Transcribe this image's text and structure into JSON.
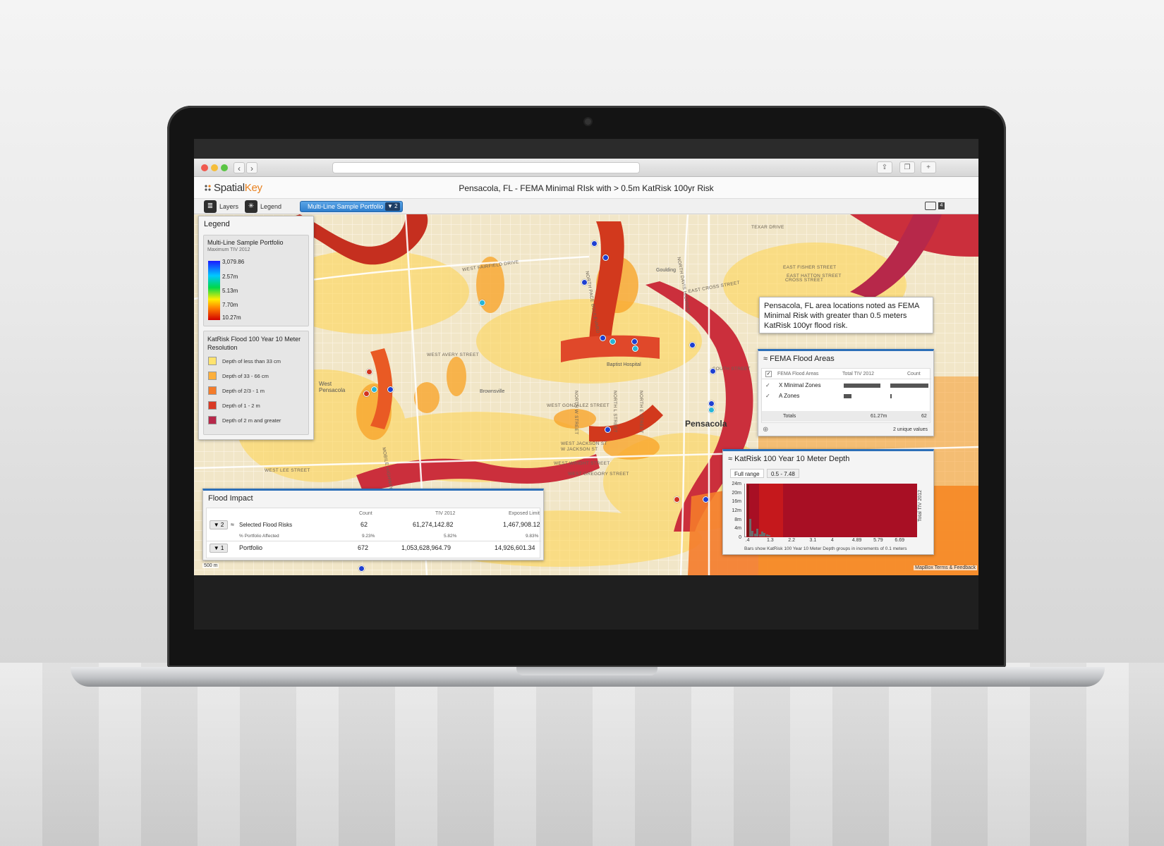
{
  "browser": {
    "traffic_lights": [
      "#f05a4f",
      "#f5bd3a",
      "#5ac544"
    ],
    "back": "‹",
    "forward": "›"
  },
  "app": {
    "logo_prefix": "Spatial",
    "logo_suffix": "Key",
    "page_title": "Pensacola, FL - FEMA Minimal RIsk with > 0.5m KatRisk 100yr Risk"
  },
  "toolbar": {
    "layers_label": "Layers",
    "legend_label": "Legend",
    "portfolio_pill": "Multi-Line Sample Portfolio",
    "portfolio_badge": "2",
    "screens_count": "4"
  },
  "legend": {
    "title": "Legend",
    "portfolio": {
      "title": "Multi-Line Sample Portfolio",
      "subtitle": "Maximum TIV 2012",
      "scale": [
        "3,079.86",
        "2.57m",
        "5.13m",
        "7.70m",
        "10.27m"
      ]
    },
    "flood": {
      "title": "KatRisk Flood 100 Year 10 Meter Resolution",
      "items": [
        {
          "label": "Depth of less than 33 cm",
          "color": "#ffe36e"
        },
        {
          "label": "Depth of 33 - 66 cm",
          "color": "#fcaf3b"
        },
        {
          "label": "Depth of 2/3 - 1 m",
          "color": "#f47b2a"
        },
        {
          "label": "Depth of 1 - 2 m",
          "color": "#d93a25"
        },
        {
          "label": "Depth of 2 m and greater",
          "color": "#b7284a"
        }
      ]
    }
  },
  "callout": {
    "text": "Pensacola, FL area locations noted as FEMA Minimal Risk with greater than 0.5 meters KatRisk 100yr flood risk."
  },
  "fema": {
    "title": "FEMA Flood Areas",
    "headers": [
      "FEMA Flood Areas",
      "Total TIV 2012",
      "Count"
    ],
    "rows": [
      {
        "name": "X Minimal Zones",
        "tiv_fraction": 0.96,
        "count_fraction": 0.97
      },
      {
        "name": "A Zones",
        "tiv_fraction": 0.2,
        "count_fraction": 0.04
      }
    ],
    "totals_label": "Totals",
    "totals_tiv": "61.27m",
    "totals_count": "62",
    "unique": "2 unique values"
  },
  "katrisk": {
    "title": "KatRisk 100 Year 10 Meter Depth",
    "chip_full": "Full range",
    "chip_range": "0.5 - 7.48",
    "y_axis_label": "Total TIV 2012",
    "footnote": "Bars show KatRisk 100 Year 10 Meter Depth groups in increments of 0.1 meters"
  },
  "chart_data": {
    "type": "bar",
    "title": "KatRisk 100 Year 10 Meter Depth",
    "ylabel": "Total TIV 2012",
    "xlabel": "",
    "y_ticks": [
      "24m",
      "20m",
      "16m",
      "12m",
      "8m",
      "4m",
      "0"
    ],
    "x_ticks": [
      ".4",
      "1.3",
      "2.2",
      "3.1",
      "4",
      "4.89",
      "5.79",
      "6.69"
    ],
    "ylim": [
      0,
      24
    ],
    "x": [
      0.4,
      0.5,
      0.6,
      0.7,
      0.8,
      0.9,
      1.0,
      1.1,
      1.2,
      1.3
    ],
    "values": [
      23,
      8,
      2.5,
      1.2,
      3.5,
      1.0,
      2.2,
      1.5,
      0.8,
      0.6
    ],
    "selected_range": [
      0.5,
      7.48
    ]
  },
  "flood_impact": {
    "title": "Flood Impact",
    "headers": [
      "Count",
      "TIV 2012",
      "Exposed Limit"
    ],
    "rows": [
      {
        "filter": "2",
        "label": "Selected Flood Risks",
        "count": "62",
        "tiv": "61,274,142.82",
        "limit": "1,467,908.12",
        "sub_label": "% Portfolio Affected",
        "sub_count": "9.23%",
        "sub_tiv": "5.82%",
        "sub_limit": "9.83%"
      },
      {
        "filter": "1",
        "label": "Portfolio",
        "count": "672",
        "tiv": "1,053,628,964.79",
        "limit": "14,926,601.34"
      }
    ]
  },
  "map": {
    "city": "Pensacola",
    "scale": "500 m",
    "attribution": "MapBox Terms & Feedback",
    "hospital": "Baptist Hospital",
    "brownsville": "Brownsville",
    "west_pensacola": "West\nPensacola",
    "goulding": "Goulding",
    "streets": [
      "WEST FAIRFIELD DRIVE",
      "WEST AVERY STREET",
      "WEST JACKSON ST",
      "W JACKSON ST",
      "WEST WRIGHT STREET",
      "WEST GREGORY STREET",
      "NORTH PACE BOULEVARD",
      "EAST CROSS STREET",
      "EAST FISHER STREET",
      "EAST HATTON STREET",
      "NORTH DAVIS HIGHWAY",
      "WEST GONZALEZ STREET",
      "TEXAR DRIVE",
      "CROSS STREET",
      "SOUTH STREET",
      "WEST LEE STREET",
      "MOBILE HIGHWAY",
      "NORTH W STREET",
      "NORTH L STREET",
      "NORTH E STREET"
    ]
  }
}
